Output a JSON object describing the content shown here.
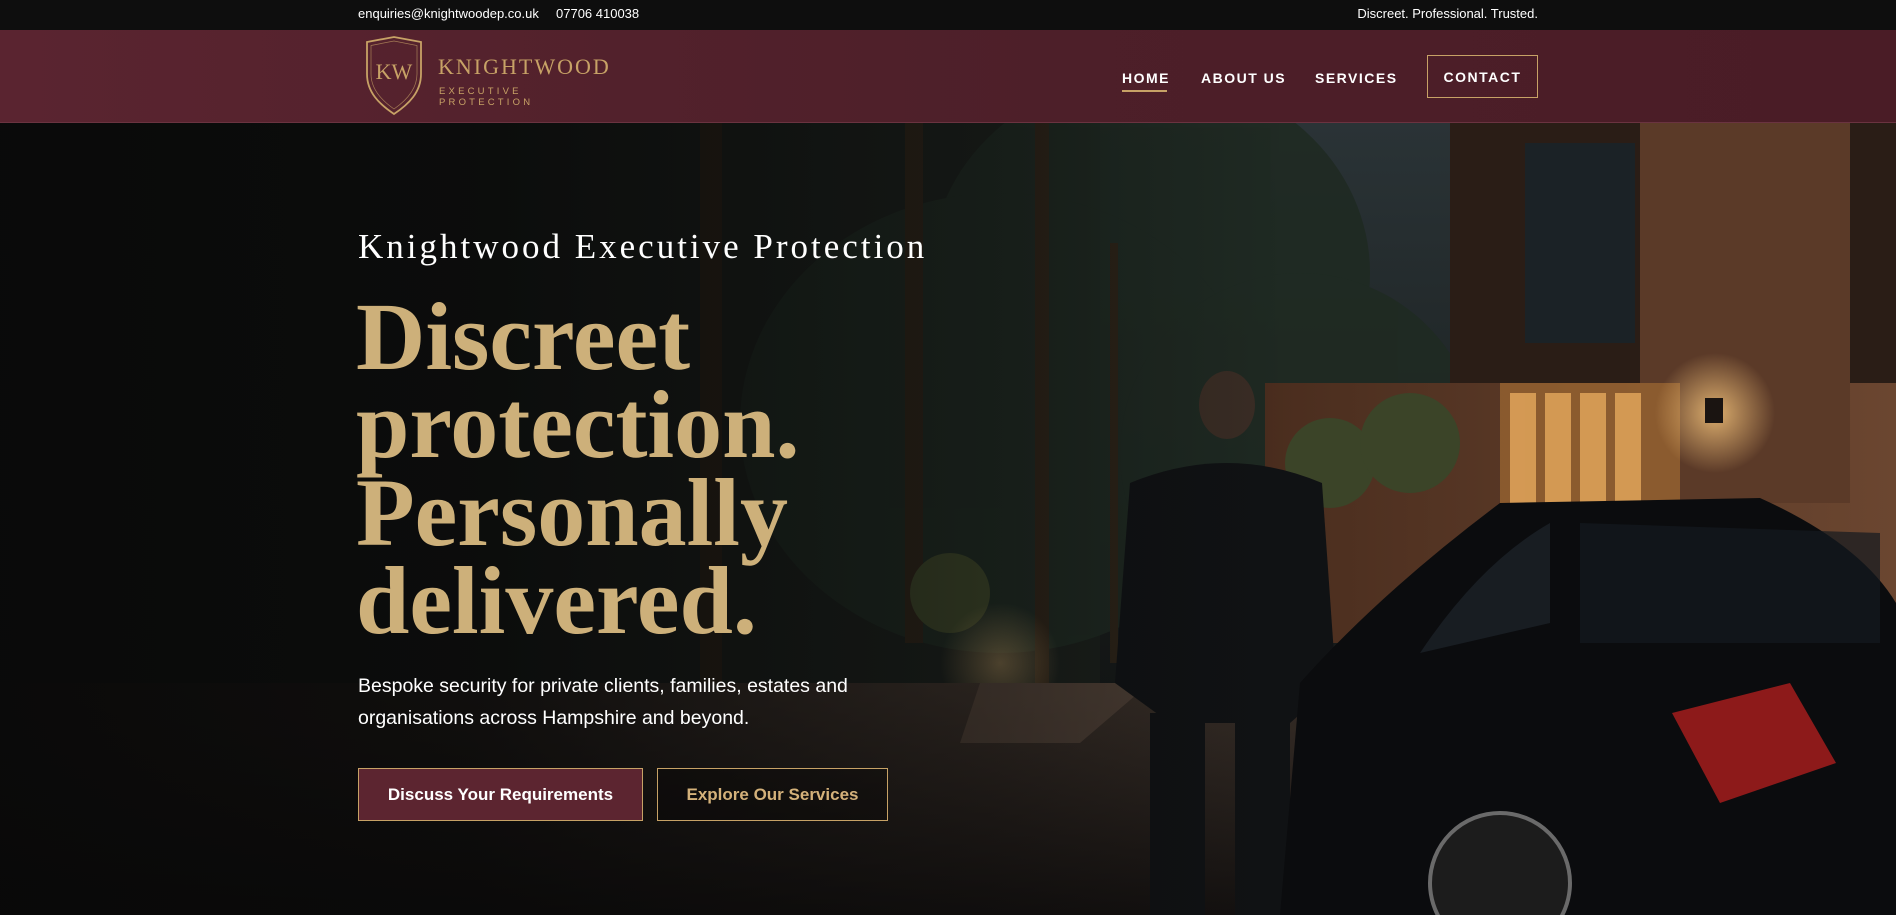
{
  "topbar": {
    "email": "enquiries@knightwoodep.co.uk",
    "phone": "07706 410038",
    "tagline": "Discreet. Professional. Trusted."
  },
  "logo": {
    "monogram": "KW",
    "title": "KNIGHTWOOD",
    "subtitle": "EXECUTIVE PROTECTION"
  },
  "nav": {
    "items": [
      {
        "label": "HOME",
        "active": true
      },
      {
        "label": "ABOUT US",
        "active": false
      },
      {
        "label": "SERVICES",
        "active": false
      }
    ],
    "cta": "CONTACT"
  },
  "hero": {
    "eyebrow": "Knightwood Executive Protection",
    "title_lines": [
      "Discreet",
      "protection.",
      "Personally",
      "delivered."
    ],
    "description": "Bespoke security for private clients, families, estates and organisations across Hampshire and beyond.",
    "primary_button": "Discuss Your Requirements",
    "secondary_button": "Explore Our Services"
  },
  "colors": {
    "brand_maroon": "#5a2430",
    "accent_gold": "#c7a266",
    "headline_gold": "#cdb07a",
    "topbar_bg": "#0e0e0e"
  },
  "icons": {
    "logo": "shield-icon"
  }
}
